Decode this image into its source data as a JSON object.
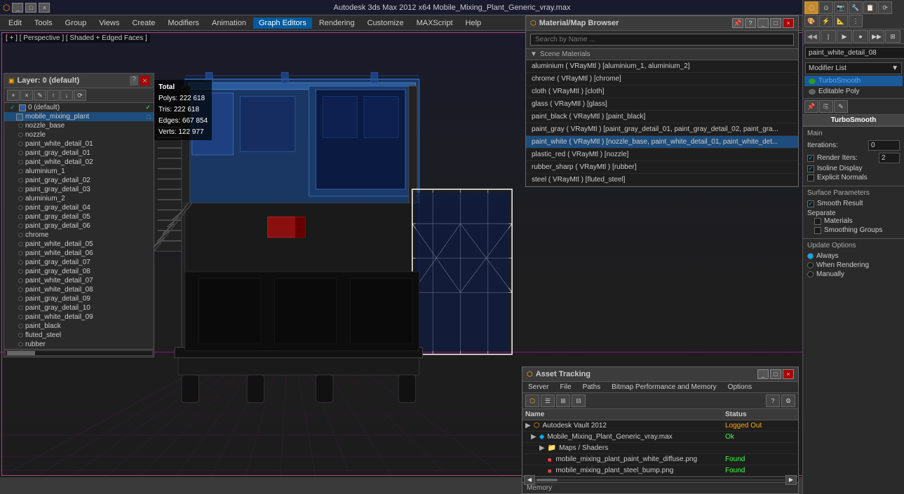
{
  "titlebar": {
    "title": "Autodesk 3ds Max 2012 x64    Mobile_Mixing_Plant_Generic_vray.max",
    "app_icon": "3dsmax-icon"
  },
  "menubar": {
    "items": [
      "Edit",
      "Tools",
      "Group",
      "Views",
      "Create",
      "Modifiers",
      "Animation",
      "Graph Editors",
      "Rendering",
      "Customize",
      "MAXScript",
      "Help"
    ]
  },
  "viewport": {
    "label": "[ + ] [ Perspective ] [ Shaded + Edged Faces ]"
  },
  "stats": {
    "total_label": "Total",
    "polys_label": "Polys:",
    "polys_value": "222 618",
    "tris_label": "Tris:",
    "tris_value": "222 618",
    "edges_label": "Edges:",
    "edges_value": "667 854",
    "verts_label": "Verts:",
    "verts_value": "122 977"
  },
  "layers_panel": {
    "title": "Layer: 0 (default)",
    "help_btn": "?",
    "close_btn": "×",
    "toolbar_btns": [
      "+",
      "×",
      "✎",
      "↑",
      "↓",
      "⟳"
    ],
    "layers": [
      {
        "name": "0 (default)",
        "indent": 0,
        "selected": false,
        "checked": true
      },
      {
        "name": "mobile_mixing_plant",
        "indent": 0,
        "selected": true,
        "checked": false
      },
      {
        "name": "nozzle_base",
        "indent": 1,
        "selected": false
      },
      {
        "name": "nozzle",
        "indent": 1,
        "selected": false
      },
      {
        "name": "paint_white_detail_01",
        "indent": 1,
        "selected": false
      },
      {
        "name": "paint_gray_detail_01",
        "indent": 1,
        "selected": false
      },
      {
        "name": "paint_white_detail_02",
        "indent": 1,
        "selected": false
      },
      {
        "name": "aluminium_1",
        "indent": 1,
        "selected": false
      },
      {
        "name": "paint_gray_detail_02",
        "indent": 1,
        "selected": false
      },
      {
        "name": "paint_gray_detail_03",
        "indent": 1,
        "selected": false
      },
      {
        "name": "aluminium_2",
        "indent": 1,
        "selected": false
      },
      {
        "name": "paint_gray_detail_04",
        "indent": 1,
        "selected": false
      },
      {
        "name": "paint_gray_detail_05",
        "indent": 1,
        "selected": false
      },
      {
        "name": "paint_gray_detail_06",
        "indent": 1,
        "selected": false
      },
      {
        "name": "chrome",
        "indent": 1,
        "selected": false
      },
      {
        "name": "paint_white_detail_05",
        "indent": 1,
        "selected": false
      },
      {
        "name": "paint_white_detail_06",
        "indent": 1,
        "selected": false
      },
      {
        "name": "paint_gray_detail_07",
        "indent": 1,
        "selected": false
      },
      {
        "name": "paint_gray_detail_08",
        "indent": 1,
        "selected": false
      },
      {
        "name": "paint_white_detail_07",
        "indent": 1,
        "selected": false
      },
      {
        "name": "paint_white_detail_08",
        "indent": 1,
        "selected": false
      },
      {
        "name": "paint_gray_detail_09",
        "indent": 1,
        "selected": false
      },
      {
        "name": "paint_gray_detail_10",
        "indent": 1,
        "selected": false
      },
      {
        "name": "paint_white_detail_09",
        "indent": 1,
        "selected": false
      },
      {
        "name": "paint_black",
        "indent": 1,
        "selected": false
      },
      {
        "name": "fluted_steel",
        "indent": 1,
        "selected": false
      },
      {
        "name": "rubber",
        "indent": 1,
        "selected": false
      }
    ]
  },
  "mat_browser": {
    "title": "Material/Map Browser",
    "search_placeholder": "Search by Name ...",
    "section_label": "Scene Materials",
    "materials": [
      {
        "name": "aluminium ( VRayMtl ) [aluminium_1, aluminium_2]",
        "selected": false
      },
      {
        "name": "chrome ( VRayMtl ) [chrome]",
        "selected": false
      },
      {
        "name": "cloth ( VRayMtl ) [cloth]",
        "selected": false
      },
      {
        "name": "glass ( VRayMtl ) [glass]",
        "selected": false
      },
      {
        "name": "paint_black ( VRayMtl ) [paint_black]",
        "selected": false
      },
      {
        "name": "paint_gray ( VRayMtl ) [paint_gray_detail_01, paint_gray_detail_02, paint_gra...",
        "selected": false
      },
      {
        "name": "paint_white ( VRayMtl ) [nozzle_base, paint_white_detail_01, paint_white_det...",
        "selected": true
      },
      {
        "name": "plastic_red ( VRayMtl ) [nozzle]",
        "selected": false
      },
      {
        "name": "rubber_sharp ( VRayMtl ) [rubber]",
        "selected": false
      },
      {
        "name": "steel ( VRayMtl ) [fluted_steel]",
        "selected": false
      }
    ]
  },
  "modifier_panel": {
    "mat_name": "paint_white_detail_08",
    "modifier_list_label": "Modifier List",
    "modifiers": [
      {
        "name": "TurboSmooth",
        "active": true
      },
      {
        "name": "Editable Poly",
        "active": false
      }
    ],
    "turbosmooth": {
      "title": "TurboSmooth",
      "main_label": "Main",
      "iterations_label": "Iterations:",
      "iterations_value": "0",
      "render_iters_label": "Render Iters:",
      "render_iters_value": "2",
      "isoline_label": "Isoline Display",
      "explicit_normals_label": "Explicit Normals",
      "surface_label": "Surface Parameters",
      "smooth_result_label": "Smooth Result",
      "separate_label": "Separate",
      "materials_label": "Materials",
      "smoothing_groups_label": "Smoothing Groups",
      "update_label": "Update Options",
      "always_label": "Always",
      "when_rendering_label": "When Rendering",
      "manually_label": "Manually"
    }
  },
  "asset_tracking": {
    "title": "Asset Tracking",
    "menu_items": [
      "Server",
      "File",
      "Paths",
      "Bitmap Performance and Memory",
      "Options"
    ],
    "columns": [
      "Name",
      "Status"
    ],
    "rows": [
      {
        "name": "Autodesk Vault 2012",
        "status": "Logged Out",
        "icon": "vault",
        "indent": 0
      },
      {
        "name": "Mobile_Mixing_Plant_Generic_vray.max",
        "status": "Ok",
        "icon": "max",
        "indent": 1
      },
      {
        "name": "Maps / Shaders",
        "status": "",
        "icon": "folder",
        "indent": 2
      },
      {
        "name": "mobile_mixing_plant_paint_white_diffuse.png",
        "status": "Found",
        "icon": "red",
        "indent": 3
      },
      {
        "name": "mobile_mixing_plant_steel_bump.png",
        "status": "Found",
        "icon": "red",
        "indent": 3
      }
    ],
    "memory_label": "Memory"
  }
}
